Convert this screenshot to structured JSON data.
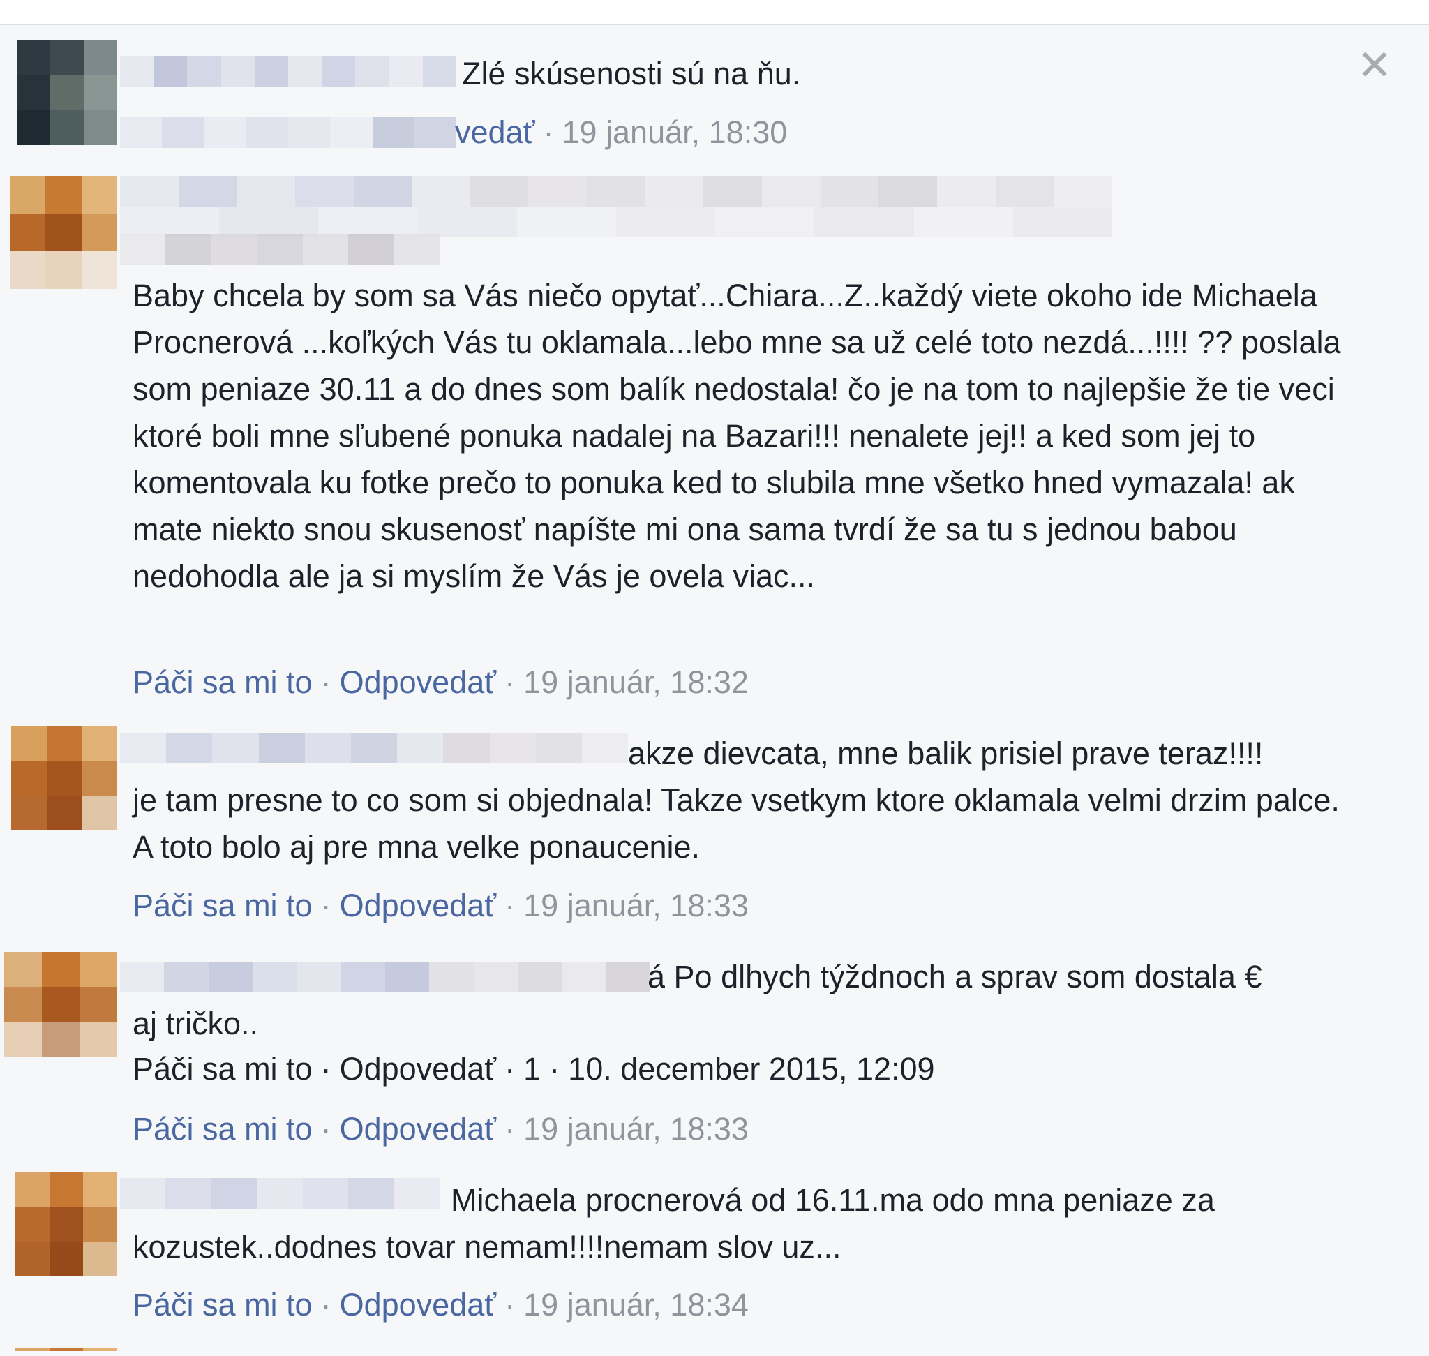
{
  "close_label": "✕",
  "colors": {
    "link": "#4b67a1",
    "meta": "#90949c",
    "text": "#1d2129"
  },
  "comments": [
    {
      "text": "Zlé skúsenosti sú na ňu.",
      "reply_fragment": "vedať",
      "timestamp": "19 január, 18:30"
    },
    {
      "text": "Baby chcela by som sa Vás niečo opytať...Chiara...Z..každý viete okoho ide Michaela Procnerová ...koľkých Vás tu oklamala...lebo mne sa už celé toto nezdá...!!!! ?? poslala som peniaze 30.11 a do dnes som balík nedostala! čo je na tom to najlepšie že tie veci ktoré boli mne sľubené ponuka nadalej na Bazari!!! nenalete jej!! a ked som jej to komentovala ku fotke prečo to ponuka ked to slubila mne všetko hned vymazala! ak mate niekto snou skusenosť napíšte mi ona sama tvrdí že sa tu s jednou babou nedohodla ale ja si myslím že Vás je ovela viac...",
      "like": "Páči sa mi to",
      "reply": "Odpovedať",
      "timestamp": "19 január, 18:32"
    },
    {
      "text_first": "akze dievcata, mne balik prisiel prave teraz!!!!",
      "text_rest": "je tam presne to co som si objednala! Takze vsetkym ktore oklamala velmi drzim palce. A toto bolo aj pre mna velke ponaucenie.",
      "like": "Páči sa mi to",
      "reply": "Odpovedať",
      "timestamp": "19 január, 18:33"
    },
    {
      "text_first": "á Po dlhych týždnoch a sprav som dostala €",
      "text_rest": "aj tričko..",
      "quoted_like": "Páči sa mi to",
      "quoted_reply": "Odpovedať",
      "quoted_count": "1",
      "quoted_timestamp": "10. december 2015, 12:09",
      "like": "Páči sa mi to",
      "reply": "Odpovedať",
      "timestamp": "19 január, 18:33"
    },
    {
      "text_first": "Michaela procnerová od 16.11.ma odo mna peniaze za",
      "text_rest": "kozustek..dodnes tovar nemam!!!!nemam slov uz...",
      "like": "Páči sa mi to",
      "reply": "Odpovedať",
      "timestamp": "19 január, 18:34"
    }
  ]
}
